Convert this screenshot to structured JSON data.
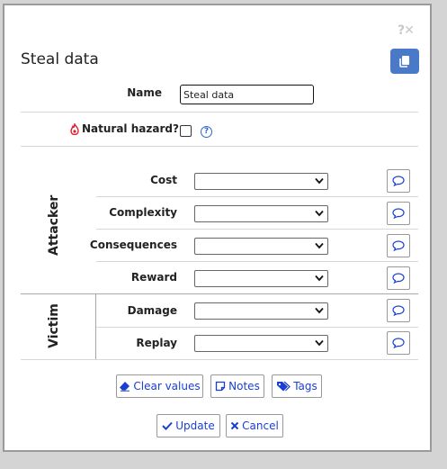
{
  "dialog": {
    "help_close": "?✕",
    "title": "Steal data",
    "copy_icon": "copy-icon"
  },
  "fields": {
    "name_label": "Name",
    "name_value": "Steal data",
    "hazard_label": "Natural hazard?",
    "hazard_checked": false,
    "help_glyph": "?"
  },
  "attacker": {
    "group_label": "Attacker",
    "rows": [
      {
        "label": "Cost",
        "value": ""
      },
      {
        "label": "Complexity",
        "value": ""
      },
      {
        "label": "Consequences",
        "value": ""
      },
      {
        "label": "Reward",
        "value": ""
      }
    ]
  },
  "victim": {
    "group_label": "Victim",
    "rows": [
      {
        "label": "Damage",
        "value": ""
      },
      {
        "label": "Replay",
        "value": ""
      }
    ]
  },
  "buttons": {
    "clear": "Clear values",
    "notes": "Notes",
    "tags": "Tags",
    "update": "Update",
    "cancel": "Cancel"
  },
  "colors": {
    "accent": "#1a3fd1",
    "copy_button": "#4a79c8",
    "hazard": "#d9202a"
  }
}
